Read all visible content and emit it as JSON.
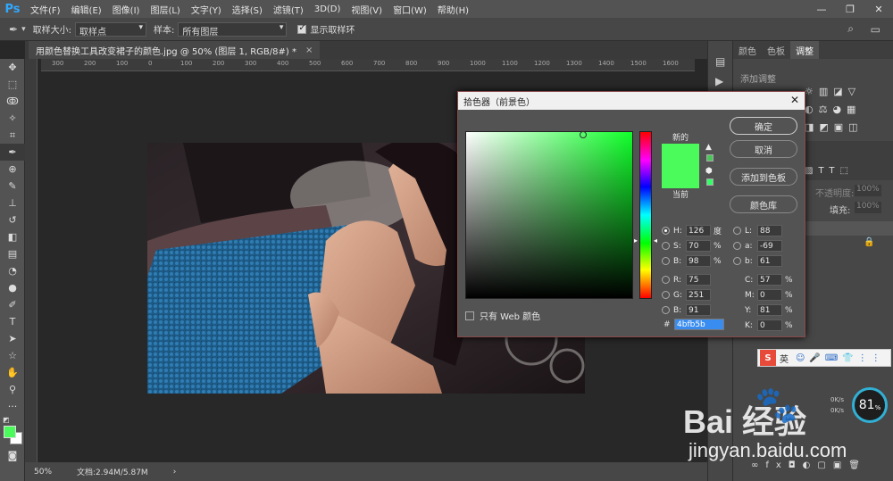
{
  "app": {
    "logo": "Ps",
    "menus": [
      "文件(F)",
      "编辑(E)",
      "图像(I)",
      "图层(L)",
      "文字(Y)",
      "选择(S)",
      "滤镜(T)",
      "3D(D)",
      "视图(V)",
      "窗口(W)",
      "帮助(H)"
    ],
    "win_min": "—",
    "win_max": "❐",
    "win_close": "✕"
  },
  "options": {
    "sample_size_label": "取样大小:",
    "sample_size_value": "取样点",
    "sample_label": "样本:",
    "sample_value": "所有图层",
    "show_ring_label": "显示取样环",
    "show_ring_checked": true
  },
  "document": {
    "tab_title": "用颜色替换工具改变裙子的颜色.jpg @ 50% (图层 1, RGB/8#) *",
    "close": "×",
    "zoom": "50%",
    "doc_info": "文档:2.94M/5.87M",
    "ruler_ticks": [
      "300",
      "200",
      "100",
      "0",
      "100",
      "200",
      "300",
      "400",
      "500",
      "600",
      "700",
      "800",
      "900",
      "1000",
      "1100",
      "1200",
      "1300",
      "1400",
      "1500",
      "1600"
    ]
  },
  "right_panel": {
    "tabs": [
      "颜色",
      "色板",
      "调整"
    ],
    "active_tab": "调整",
    "add_adjust": "添加调整",
    "opacity_label": "不透明度:",
    "opacity_value": "100%",
    "fill_label": "填充:",
    "fill_value": "100%"
  },
  "dialog": {
    "title": "拾色器（前景色）",
    "new_label": "新的",
    "current_label": "当前",
    "new_color": "#4bfb5b",
    "current_color": "#4bfb5b",
    "ok": "确定",
    "cancel": "取消",
    "add_swatch": "添加到色板",
    "color_lib": "颜色库",
    "web_only": "只有 Web 颜色",
    "fields_left": [
      {
        "label": "H:",
        "value": "126",
        "unit": "度",
        "selected": true
      },
      {
        "label": "S:",
        "value": "70",
        "unit": "%"
      },
      {
        "label": "B:",
        "value": "98",
        "unit": "%"
      },
      {
        "label": "R:",
        "value": "75",
        "unit": ""
      },
      {
        "label": "G:",
        "value": "251",
        "unit": ""
      },
      {
        "label": "B:",
        "value": "91",
        "unit": ""
      }
    ],
    "fields_right": [
      {
        "label": "L:",
        "value": "88"
      },
      {
        "label": "a:",
        "value": "-69"
      },
      {
        "label": "b:",
        "value": "61"
      }
    ],
    "cmyk": [
      {
        "label": "C:",
        "value": "57",
        "unit": "%"
      },
      {
        "label": "M:",
        "value": "0",
        "unit": "%"
      },
      {
        "label": "Y:",
        "value": "81",
        "unit": "%"
      },
      {
        "label": "K:",
        "value": "0",
        "unit": "%"
      }
    ],
    "hex_label": "#",
    "hex_value": "4bfb5b"
  },
  "overlay": {
    "ime": "英",
    "cpu_percent": "81",
    "cpu_unit": "%",
    "net_up": "0K/s",
    "net_down": "0K/s",
    "watermark_brand": "Bai 经验",
    "watermark_url": "jingyan.baidu.com"
  },
  "colors": {
    "foreground": "#4bfb5b",
    "background": "#ffffff"
  }
}
